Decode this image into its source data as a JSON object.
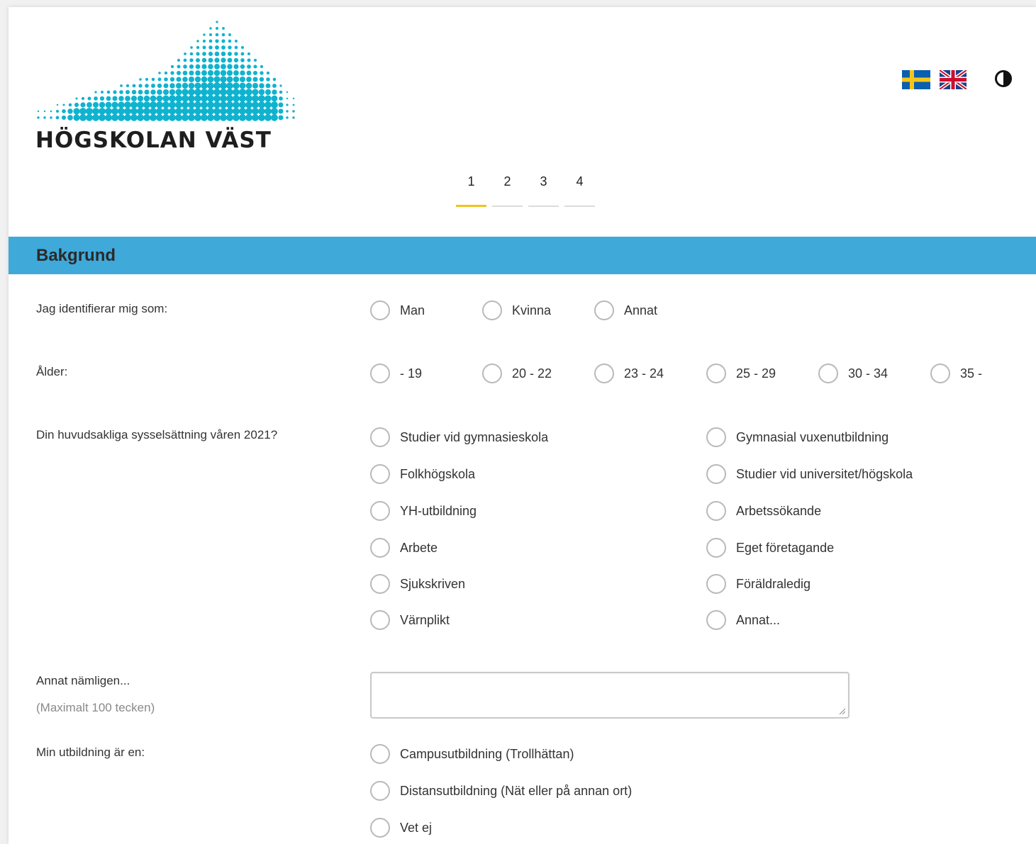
{
  "brand": {
    "logo_text": "HÖGSKOLAN VÄST"
  },
  "languages": [
    {
      "code": "sv",
      "icon": "swedish-flag-icon"
    },
    {
      "code": "en",
      "icon": "uk-flag-icon"
    }
  ],
  "contrast_icon": "contrast-icon",
  "steps": {
    "items": [
      "1",
      "2",
      "3",
      "4"
    ],
    "active": "1"
  },
  "colors": {
    "header_bar": "#3fa9da",
    "active_step": "#f0c41b",
    "logo_dots": "#0fb3cf"
  },
  "section": {
    "title": "Bakgrund"
  },
  "questions": {
    "gender": {
      "label": "Jag identifierar mig som:",
      "options": [
        "Man",
        "Kvinna",
        "Annat"
      ]
    },
    "age": {
      "label": "Ålder:",
      "options": [
        "- 19",
        "20 - 22",
        "23 - 24",
        "25 - 29",
        "30 - 34",
        "35 -"
      ]
    },
    "occupation": {
      "label": "Din huvudsakliga sysselsättning våren 2021?",
      "options_left": [
        "Studier vid gymnasieskola",
        "Folkhögskola",
        "YH-utbildning",
        "Arbete",
        "Sjukskriven",
        "Värnplikt"
      ],
      "options_right": [
        "Gymnasial vuxenutbildning",
        "Studier vid universitet/högskola",
        "Arbetssökande",
        "Eget företagande",
        "Föräldraledig",
        "Annat..."
      ]
    },
    "other": {
      "label": "Annat nämligen...",
      "hint": "(Maximalt 100 tecken)",
      "value": ""
    },
    "education": {
      "label": "Min utbildning är en:",
      "options": [
        "Campusutbildning (Trollhättan)",
        "Distansutbildning (Nät eller på annan ort)",
        "Vet ej"
      ]
    }
  }
}
